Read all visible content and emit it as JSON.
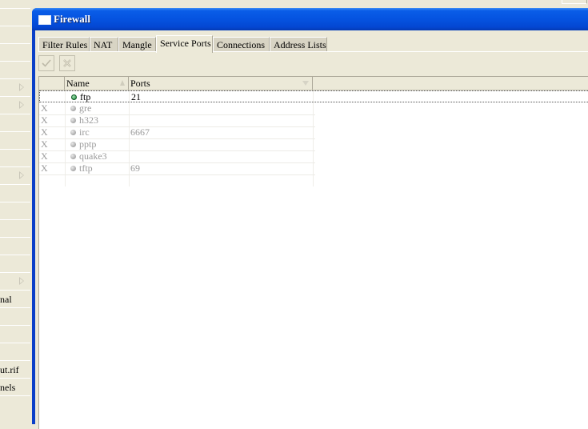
{
  "left_panel": {
    "rows": [
      {
        "text": "",
        "has_arrow": false
      },
      {
        "text": "",
        "has_arrow": false
      },
      {
        "text": "",
        "has_arrow": false
      },
      {
        "text": "",
        "has_arrow": false
      },
      {
        "text": "",
        "has_arrow": true
      },
      {
        "text": "",
        "has_arrow": true
      },
      {
        "text": "",
        "has_arrow": false
      },
      {
        "text": "",
        "has_arrow": false
      },
      {
        "text": "",
        "has_arrow": false
      },
      {
        "text": "",
        "has_arrow": true
      },
      {
        "text": "",
        "has_arrow": false
      },
      {
        "text": "",
        "has_arrow": false
      },
      {
        "text": "",
        "has_arrow": false
      },
      {
        "text": "",
        "has_arrow": false
      },
      {
        "text": "",
        "has_arrow": false
      },
      {
        "text": "",
        "has_arrow": true
      },
      {
        "text": "nal",
        "has_arrow": false
      },
      {
        "text": "",
        "has_arrow": false
      },
      {
        "text": "",
        "has_arrow": false
      },
      {
        "text": "",
        "has_arrow": false
      },
      {
        "text": "ut.rif",
        "has_arrow": false
      },
      {
        "text": "nels",
        "has_arrow": false
      },
      {
        "text": "",
        "has_arrow": false
      }
    ]
  },
  "window": {
    "title": "Firewall",
    "tabs": [
      {
        "label": "Filter Rules",
        "active": false
      },
      {
        "label": "NAT",
        "active": false
      },
      {
        "label": "Mangle",
        "active": false
      },
      {
        "label": "Service Ports",
        "active": true
      },
      {
        "label": "Connections",
        "active": false
      },
      {
        "label": "Address Lists",
        "active": false
      }
    ],
    "toolbar": {
      "enable_icon": "check-icon",
      "disable_icon": "cross-icon"
    },
    "table": {
      "columns": [
        {
          "label": "",
          "key": "flag"
        },
        {
          "label": "Name",
          "key": "name",
          "sorted": "ascending"
        },
        {
          "label": "Ports",
          "key": "ports"
        }
      ],
      "rows": [
        {
          "flag": "",
          "name": "ftp",
          "ports": "21",
          "enabled": true,
          "selected": true
        },
        {
          "flag": "X",
          "name": "gre",
          "ports": "",
          "enabled": false,
          "selected": false
        },
        {
          "flag": "X",
          "name": "h323",
          "ports": "",
          "enabled": false,
          "selected": false
        },
        {
          "flag": "X",
          "name": "irc",
          "ports": "6667",
          "enabled": false,
          "selected": false
        },
        {
          "flag": "X",
          "name": "pptp",
          "ports": "",
          "enabled": false,
          "selected": false
        },
        {
          "flag": "X",
          "name": "quake3",
          "ports": "",
          "enabled": false,
          "selected": false
        },
        {
          "flag": "X",
          "name": "tftp",
          "ports": "69",
          "enabled": false,
          "selected": false
        }
      ]
    }
  }
}
